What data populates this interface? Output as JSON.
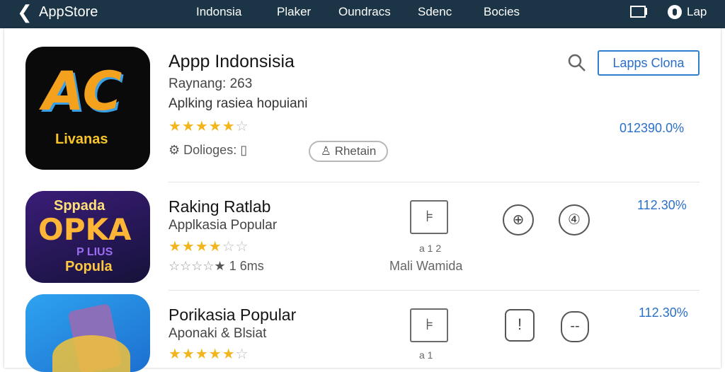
{
  "header": {
    "app_title": "AppStore",
    "nav": [
      "Indonsia",
      "Plaker",
      "Oundracs",
      "Sdenc",
      "Bocies"
    ],
    "right_label": "Lap"
  },
  "featured": {
    "title": "Appp Indonsisia",
    "rating_text": "Raynang: 263",
    "subtitle": "Aplking rasiea hopuiani",
    "stars": 4.5,
    "meta_label": "Dolioges:",
    "action_button": "Lapps Clona",
    "tag_button": "Rhetain",
    "percent": "012390.0%",
    "icon_text_big": "AC",
    "icon_text_small": "Livanas"
  },
  "list": [
    {
      "title": "Raking Ratlab",
      "subtitle": "Applkasia Popular",
      "stars": 4,
      "extra_text": "1 6ms",
      "mid_label_small": "a 1 2",
      "mid_label": "Mali Wamida",
      "percent": "112.30%",
      "icon_top": "Sppada",
      "icon_mid": "OPKA",
      "icon_line": "P LIUS",
      "icon_bottom": "Popula"
    },
    {
      "title": "Porikasia Popular",
      "subtitle": "Aponaki & Blsiat",
      "stars": 4.5,
      "extra_text": "",
      "mid_label_small": "a 1",
      "mid_label": "",
      "percent": "112.30%"
    }
  ],
  "colors": {
    "topbar": "#1b3547",
    "accent": "#2b6fc7",
    "star": "#f2b51c"
  }
}
